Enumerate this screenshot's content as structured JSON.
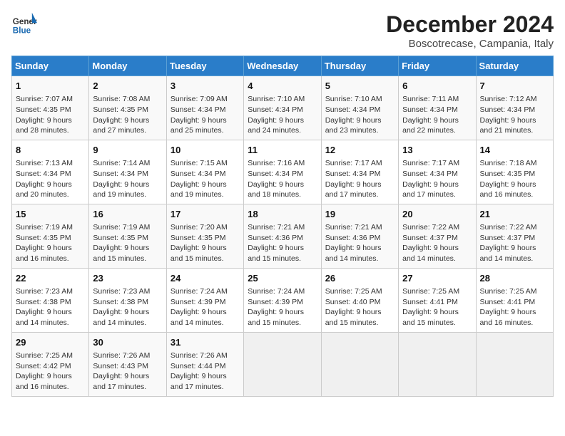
{
  "header": {
    "logo_general": "General",
    "logo_blue": "Blue",
    "month_title": "December 2024",
    "location": "Boscotrecase, Campania, Italy"
  },
  "weekdays": [
    "Sunday",
    "Monday",
    "Tuesday",
    "Wednesday",
    "Thursday",
    "Friday",
    "Saturday"
  ],
  "weeks": [
    [
      {
        "day": "1",
        "sunrise": "7:07 AM",
        "sunset": "4:35 PM",
        "daylight": "9 hours and 28 minutes."
      },
      {
        "day": "2",
        "sunrise": "7:08 AM",
        "sunset": "4:35 PM",
        "daylight": "9 hours and 27 minutes."
      },
      {
        "day": "3",
        "sunrise": "7:09 AM",
        "sunset": "4:34 PM",
        "daylight": "9 hours and 25 minutes."
      },
      {
        "day": "4",
        "sunrise": "7:10 AM",
        "sunset": "4:34 PM",
        "daylight": "9 hours and 24 minutes."
      },
      {
        "day": "5",
        "sunrise": "7:10 AM",
        "sunset": "4:34 PM",
        "daylight": "9 hours and 23 minutes."
      },
      {
        "day": "6",
        "sunrise": "7:11 AM",
        "sunset": "4:34 PM",
        "daylight": "9 hours and 22 minutes."
      },
      {
        "day": "7",
        "sunrise": "7:12 AM",
        "sunset": "4:34 PM",
        "daylight": "9 hours and 21 minutes."
      }
    ],
    [
      {
        "day": "8",
        "sunrise": "7:13 AM",
        "sunset": "4:34 PM",
        "daylight": "9 hours and 20 minutes."
      },
      {
        "day": "9",
        "sunrise": "7:14 AM",
        "sunset": "4:34 PM",
        "daylight": "9 hours and 19 minutes."
      },
      {
        "day": "10",
        "sunrise": "7:15 AM",
        "sunset": "4:34 PM",
        "daylight": "9 hours and 19 minutes."
      },
      {
        "day": "11",
        "sunrise": "7:16 AM",
        "sunset": "4:34 PM",
        "daylight": "9 hours and 18 minutes."
      },
      {
        "day": "12",
        "sunrise": "7:17 AM",
        "sunset": "4:34 PM",
        "daylight": "9 hours and 17 minutes."
      },
      {
        "day": "13",
        "sunrise": "7:17 AM",
        "sunset": "4:34 PM",
        "daylight": "9 hours and 17 minutes."
      },
      {
        "day": "14",
        "sunrise": "7:18 AM",
        "sunset": "4:35 PM",
        "daylight": "9 hours and 16 minutes."
      }
    ],
    [
      {
        "day": "15",
        "sunrise": "7:19 AM",
        "sunset": "4:35 PM",
        "daylight": "9 hours and 16 minutes."
      },
      {
        "day": "16",
        "sunrise": "7:19 AM",
        "sunset": "4:35 PM",
        "daylight": "9 hours and 15 minutes."
      },
      {
        "day": "17",
        "sunrise": "7:20 AM",
        "sunset": "4:35 PM",
        "daylight": "9 hours and 15 minutes."
      },
      {
        "day": "18",
        "sunrise": "7:21 AM",
        "sunset": "4:36 PM",
        "daylight": "9 hours and 15 minutes."
      },
      {
        "day": "19",
        "sunrise": "7:21 AM",
        "sunset": "4:36 PM",
        "daylight": "9 hours and 14 minutes."
      },
      {
        "day": "20",
        "sunrise": "7:22 AM",
        "sunset": "4:37 PM",
        "daylight": "9 hours and 14 minutes."
      },
      {
        "day": "21",
        "sunrise": "7:22 AM",
        "sunset": "4:37 PM",
        "daylight": "9 hours and 14 minutes."
      }
    ],
    [
      {
        "day": "22",
        "sunrise": "7:23 AM",
        "sunset": "4:38 PM",
        "daylight": "9 hours and 14 minutes."
      },
      {
        "day": "23",
        "sunrise": "7:23 AM",
        "sunset": "4:38 PM",
        "daylight": "9 hours and 14 minutes."
      },
      {
        "day": "24",
        "sunrise": "7:24 AM",
        "sunset": "4:39 PM",
        "daylight": "9 hours and 14 minutes."
      },
      {
        "day": "25",
        "sunrise": "7:24 AM",
        "sunset": "4:39 PM",
        "daylight": "9 hours and 15 minutes."
      },
      {
        "day": "26",
        "sunrise": "7:25 AM",
        "sunset": "4:40 PM",
        "daylight": "9 hours and 15 minutes."
      },
      {
        "day": "27",
        "sunrise": "7:25 AM",
        "sunset": "4:41 PM",
        "daylight": "9 hours and 15 minutes."
      },
      {
        "day": "28",
        "sunrise": "7:25 AM",
        "sunset": "4:41 PM",
        "daylight": "9 hours and 16 minutes."
      }
    ],
    [
      {
        "day": "29",
        "sunrise": "7:25 AM",
        "sunset": "4:42 PM",
        "daylight": "9 hours and 16 minutes."
      },
      {
        "day": "30",
        "sunrise": "7:26 AM",
        "sunset": "4:43 PM",
        "daylight": "9 hours and 17 minutes."
      },
      {
        "day": "31",
        "sunrise": "7:26 AM",
        "sunset": "4:44 PM",
        "daylight": "9 hours and 17 minutes."
      },
      null,
      null,
      null,
      null
    ]
  ],
  "labels": {
    "sunrise": "Sunrise:",
    "sunset": "Sunset:",
    "daylight": "Daylight:"
  }
}
